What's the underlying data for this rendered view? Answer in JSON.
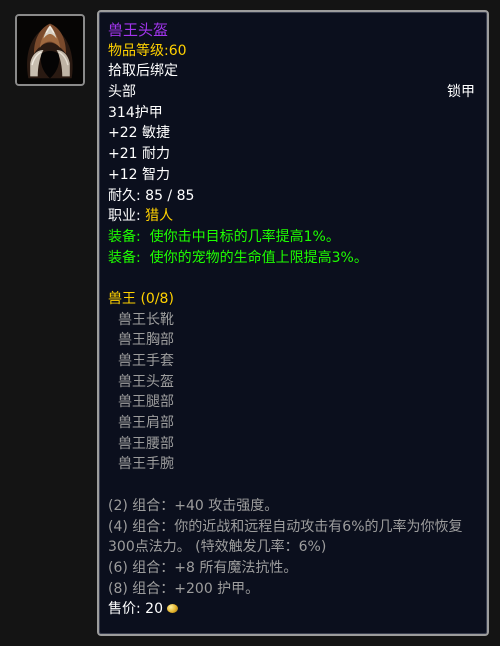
{
  "item": {
    "name": "兽王头盔",
    "item_level_label": "物品等级:",
    "item_level": "60",
    "bind": "拾取后绑定",
    "slot": "头部",
    "armor_type": "锁甲",
    "armor": "314护甲",
    "stats": [
      "+22 敏捷",
      "+21 耐力",
      "+12 智力"
    ],
    "durability_label": "耐久:",
    "durability": "85 / 85",
    "class_label": "职业:",
    "class_value": "猎人",
    "equip_effects": [
      {
        "label": "装备:",
        "text": "使你击中目标的几率提高1%。"
      },
      {
        "label": "装备:",
        "text": "使你的宠物的生命值上限提高3%。"
      }
    ],
    "sell_label": "售价:",
    "sell_value": "20"
  },
  "set": {
    "title": "兽王 (0/8)",
    "pieces": [
      "兽王长靴",
      "兽王胸部",
      "兽王手套",
      "兽王头盔",
      "兽王腿部",
      "兽王肩部",
      "兽王腰部",
      "兽王手腕"
    ],
    "bonuses": [
      "(2) 组合：+40 攻击强度。",
      "(4) 组合：你的近战和远程自动攻击有6%的几率为你恢复300点法力。 (特效触发几率：6%)",
      "(6) 组合：+8 所有魔法抗性。",
      "(8) 组合：+200 护甲。"
    ]
  },
  "colors": {
    "epic": "#a335ee",
    "yellow": "#ffd100",
    "green": "#1eff00",
    "gray": "#9d9d9d"
  },
  "icons": {
    "item_icon": "helmet-icon",
    "currency_icon": "gold-coin-icon"
  }
}
